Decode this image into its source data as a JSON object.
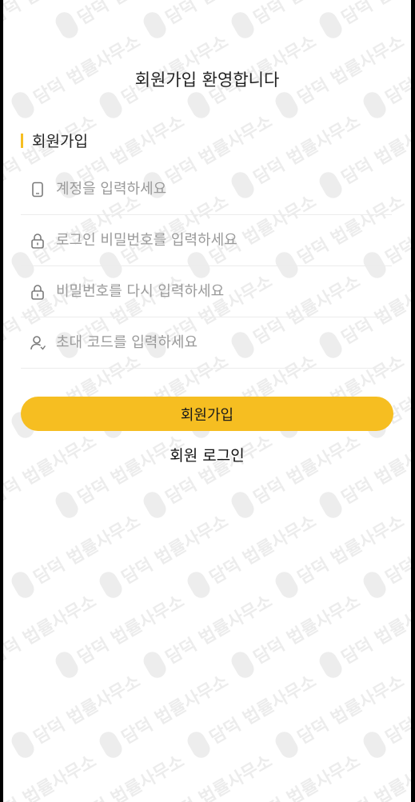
{
  "header": {
    "title": "회원가입 환영합니다"
  },
  "section": {
    "title": "회원가입"
  },
  "form": {
    "fields": [
      {
        "name": "account",
        "icon": "phone-icon",
        "placeholder": "계정을 입력하세요",
        "value": ""
      },
      {
        "name": "password",
        "icon": "lock-icon",
        "placeholder": "로그인 비밀번호를 입력하세요",
        "value": ""
      },
      {
        "name": "password-confirm",
        "icon": "lock-icon",
        "placeholder": "비밀번호를 다시 입력하세요",
        "value": ""
      },
      {
        "name": "invite-code",
        "icon": "user-icon",
        "placeholder": "초대 코드를 입력하세요",
        "value": ""
      }
    ],
    "submit_label": "회원가입",
    "login_link_label": "회원 로그인"
  },
  "watermark": {
    "text": "담덕 법률사무소"
  },
  "colors": {
    "accent": "#f6be21",
    "placeholder": "#9a9a9a",
    "divider": "#ececec",
    "text": "#222222"
  }
}
